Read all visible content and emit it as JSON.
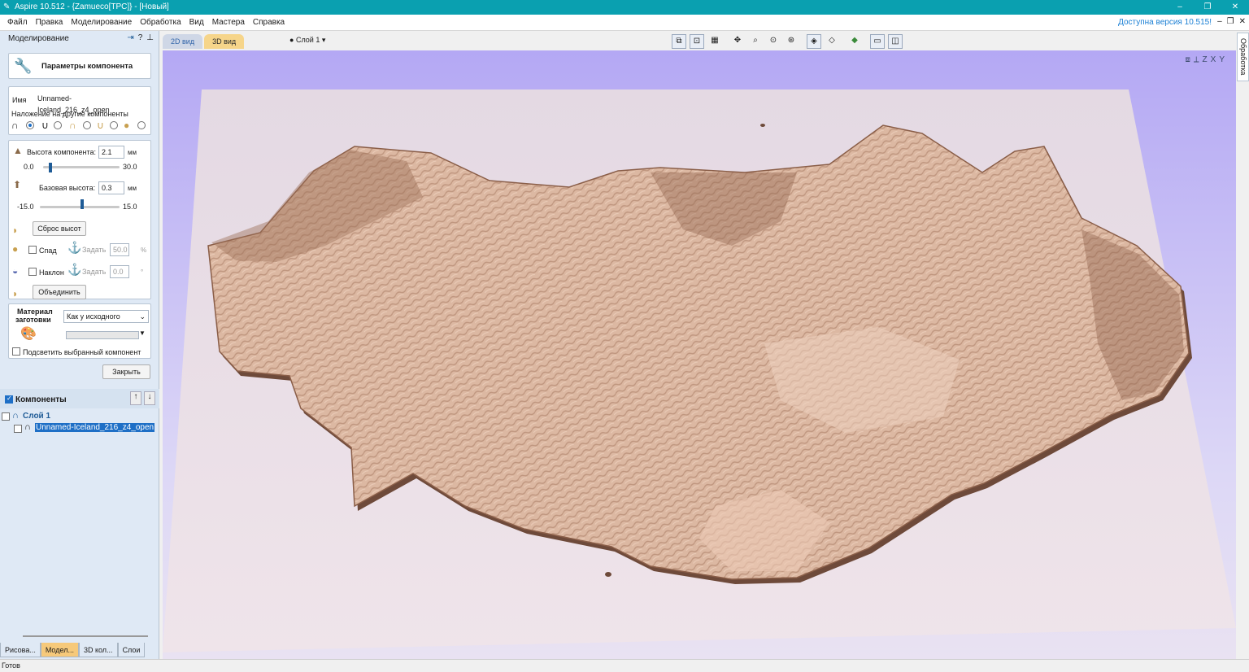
{
  "window": {
    "title": "Aspire 10.512 - {Zamueco[TPC]} - [Новый]",
    "controls": [
      "–",
      "❐",
      "✕"
    ]
  },
  "menu": {
    "items": [
      "Файл",
      "Правка",
      "Моделирование",
      "Обработка",
      "Вид",
      "Мастера",
      "Справка"
    ],
    "update_notice": "Доступна версия 10.515!",
    "mdi_controls": [
      "–",
      "❐",
      "✕"
    ]
  },
  "left_panel": {
    "header": "Моделирование",
    "header_icons": [
      "pin-icon",
      "help-icon",
      "pushpin-icon"
    ],
    "component_params_button": "Параметры компонента",
    "name_label": "Имя",
    "name_value": "Unnamed-Iceland_216_z4_open",
    "overlay_label": "Наложение на другие компоненты",
    "overlay_modes": [
      {
        "icon": "add-mode-icon",
        "selected": true
      },
      {
        "icon": "subtract-mode-icon",
        "selected": false
      },
      {
        "icon": "merge-high-icon",
        "selected": false
      },
      {
        "icon": "merge-low-icon",
        "selected": false
      },
      {
        "icon": "multiply-mode-icon",
        "selected": false
      }
    ],
    "height": {
      "label": "Высота компонента:",
      "value": "2.1",
      "unit": "мм",
      "min": "0.0",
      "max": "30.0",
      "level": 0.07
    },
    "base_height": {
      "label": "Базовая высота:",
      "value": "0.3",
      "unit": "мм",
      "min": "-15.0",
      "max": "15.0",
      "level": 0.51
    },
    "reset_button": "Сброс высот",
    "fade": {
      "label": "Спад",
      "set_label": "Задать",
      "value": "50.0",
      "unit": "%",
      "checked": false
    },
    "tilt": {
      "label": "Наклон",
      "set_label": "Задать",
      "value": "0.0",
      "unit": "°",
      "checked": false
    },
    "merge_button": "Объединить",
    "material_label_1": "Материал",
    "material_label_2": "заготовки",
    "material_select": "Как у исходного",
    "highlight_label": "Подсветить выбранный компонент",
    "close_button": "Закрыть"
  },
  "components": {
    "header": "Компоненты",
    "layer": "Слой 1",
    "item": "Unnamed-Iceland_216_z4_open"
  },
  "bottom_tabs": [
    "Рисова...",
    "Модел...",
    "3D кол...",
    "Слои"
  ],
  "view_tabs": [
    "2D вид",
    "3D вид"
  ],
  "layer_selector": "Слой 1 ▾",
  "side_tab": "Обработка",
  "status": "Готов",
  "colors": {
    "titlebar": "#0aa0b0",
    "relief": "#d9b39c",
    "relief_shadow": "#6e4a3a",
    "board": "#ece2e8",
    "accent": "#1e6fc6"
  }
}
